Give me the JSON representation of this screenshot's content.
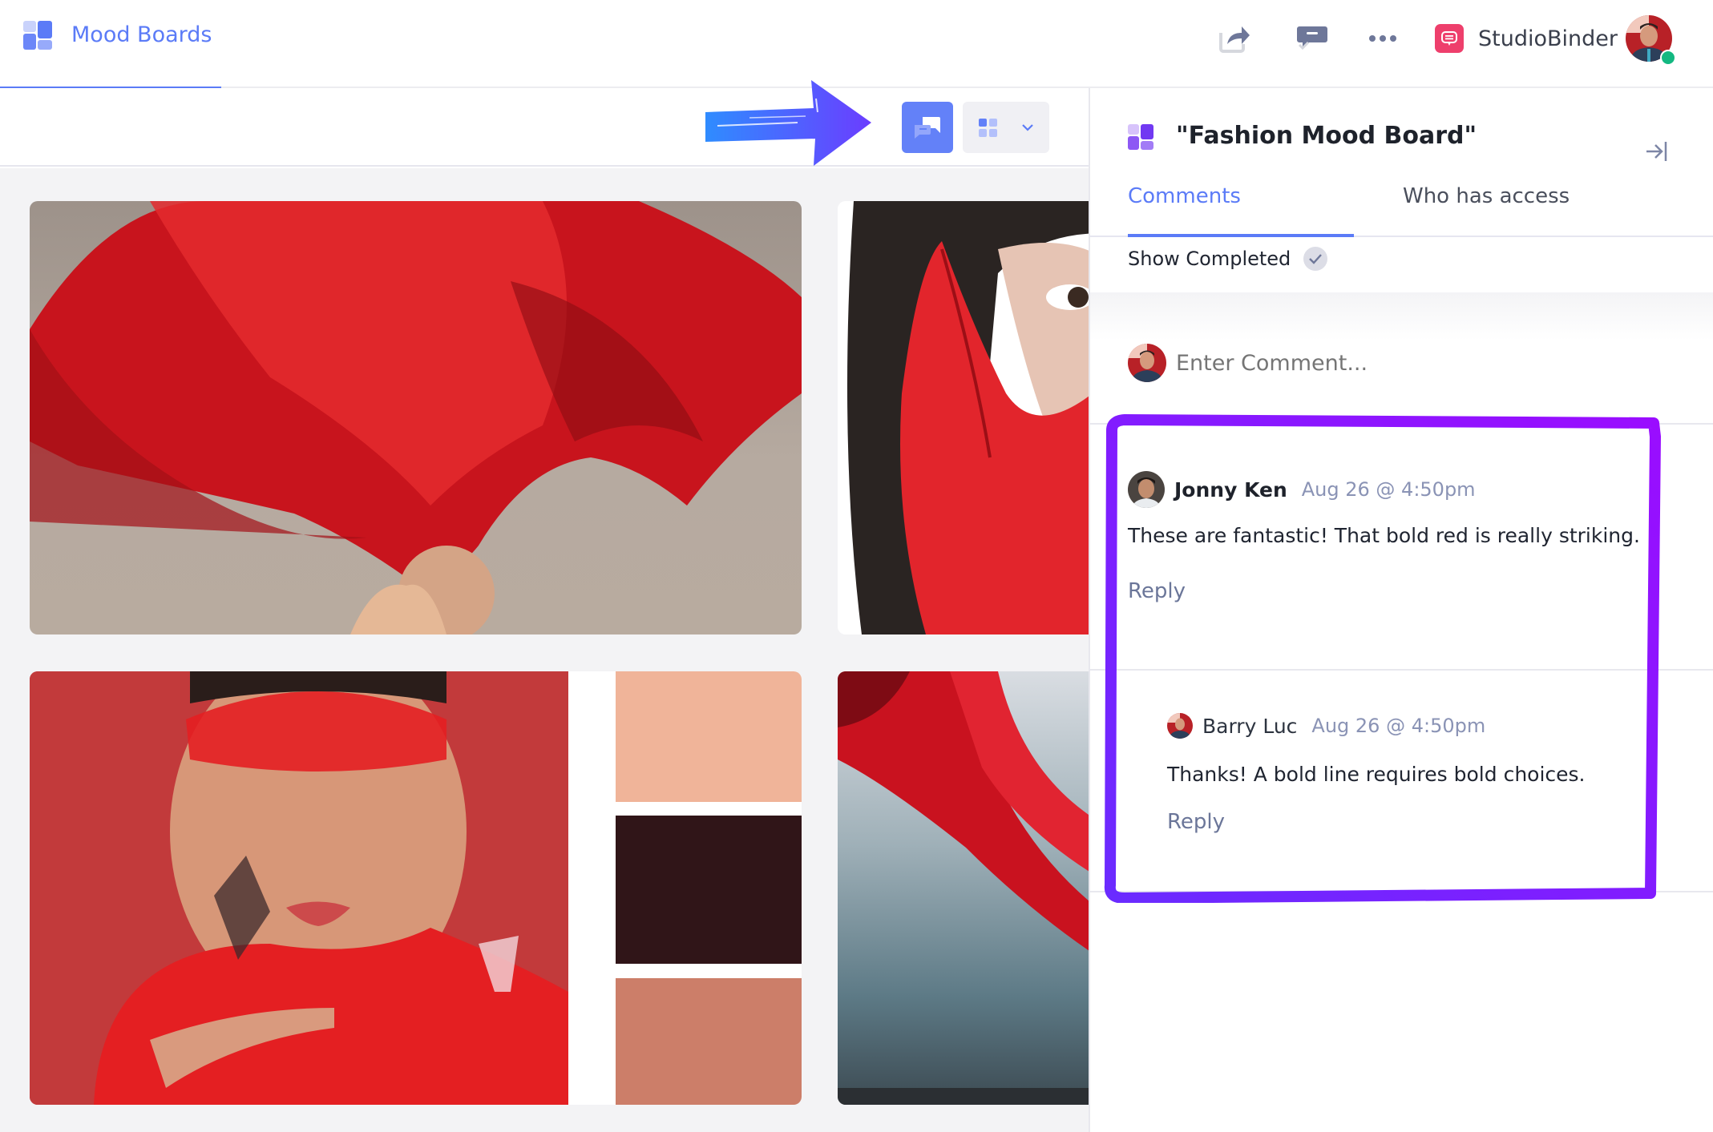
{
  "app": {
    "title": "Mood Boards",
    "brand_name": "StudioBinder",
    "accent_color": "#5b7bf7",
    "brand_color": "#ee3f6c",
    "highlight_color": "#8b10ff"
  },
  "header_actions": [
    {
      "name": "share",
      "icon": "share-icon"
    },
    {
      "name": "comments",
      "icon": "comment-check-icon"
    },
    {
      "name": "more",
      "icon": "ellipsis-icon"
    }
  ],
  "toolbar": {
    "comment_toggle_icon": "comments-icon",
    "view_toggle_icon": "grid-view-icon",
    "view_dropdown_icon": "chevron-down-icon"
  },
  "board": {
    "cards": [
      {
        "type": "photo",
        "description": "Figure with flowing red fabric"
      },
      {
        "type": "photo",
        "description": "Woman with red leather glove"
      },
      {
        "type": "photo+palette",
        "description": "Model with red eye makeup and butterflies"
      },
      {
        "type": "photo",
        "description": "Red fabric over sea"
      }
    ],
    "palette": [
      "#f0b499",
      "#301518",
      "#cc7e69"
    ]
  },
  "panel": {
    "title": "\"Fashion Mood Board\"",
    "tabs": [
      {
        "label": "Comments",
        "active": true
      },
      {
        "label": "Who has access",
        "active": false
      }
    ],
    "show_completed_label": "Show Completed",
    "comment_placeholder": "Enter Comment...",
    "comments": [
      {
        "author": "Jonny Ken",
        "time": "Aug 26 @ 4:50pm",
        "body": "These are fantastic! That bold red is really striking.",
        "reply_label": "Reply"
      },
      {
        "author": "Barry Luc",
        "time": "Aug 26 @ 4:50pm",
        "body": "Thanks! A bold line requires bold choices.",
        "reply_label": "Reply",
        "is_reply": true
      }
    ]
  }
}
